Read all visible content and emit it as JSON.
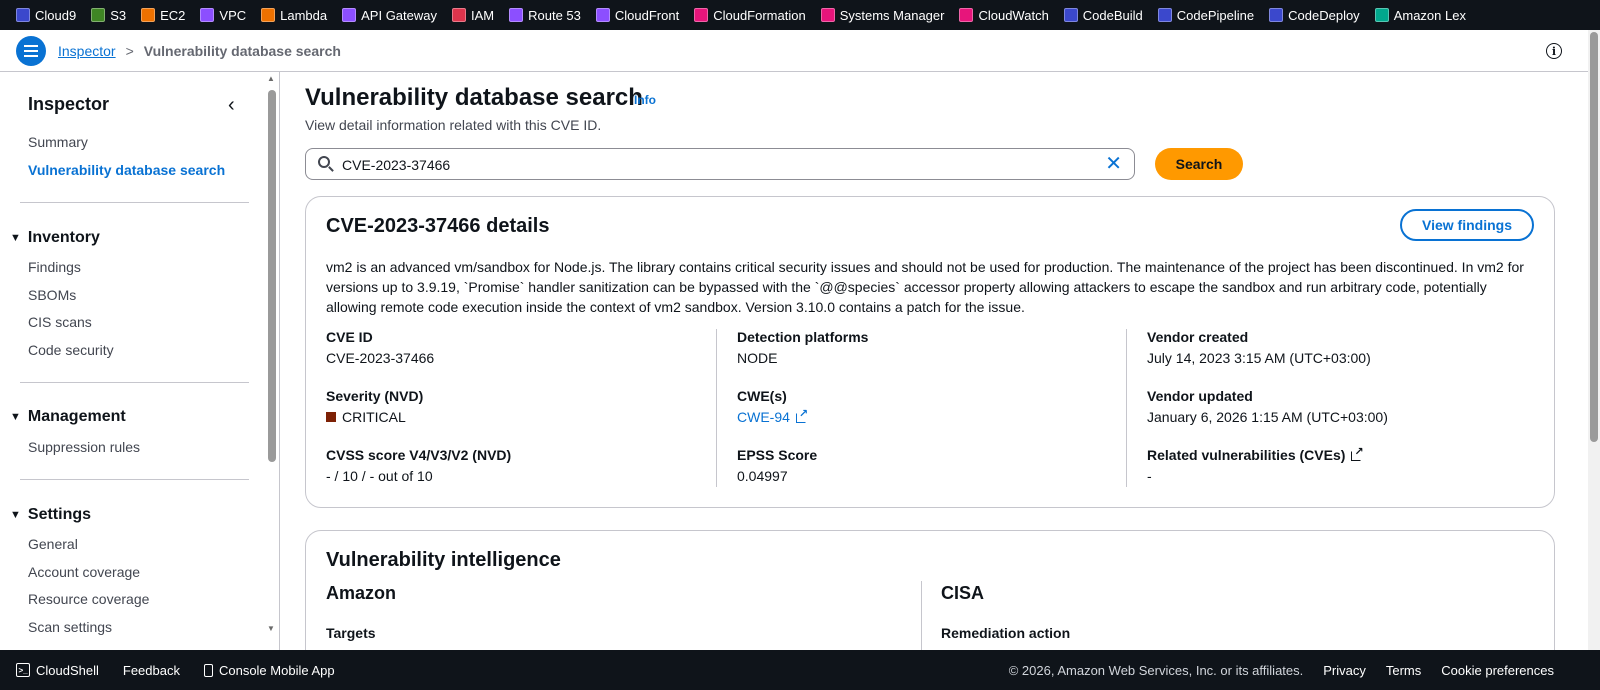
{
  "services": [
    {
      "label": "Cloud9",
      "icon": "cloud9-icon",
      "color": "#3b48cc"
    },
    {
      "label": "S3",
      "icon": "s3-icon",
      "color": "#3f8624"
    },
    {
      "label": "EC2",
      "icon": "ec2-icon",
      "color": "#ed7100"
    },
    {
      "label": "VPC",
      "icon": "vpc-icon",
      "color": "#8c4fff"
    },
    {
      "label": "Lambda",
      "icon": "lambda-icon",
      "color": "#ed7100"
    },
    {
      "label": "API Gateway",
      "icon": "api-gateway-icon",
      "color": "#8c4fff"
    },
    {
      "label": "IAM",
      "icon": "iam-icon",
      "color": "#dd344c"
    },
    {
      "label": "Route 53",
      "icon": "route53-icon",
      "color": "#8c4fff"
    },
    {
      "label": "CloudFront",
      "icon": "cloudfront-icon",
      "color": "#8c4fff"
    },
    {
      "label": "CloudFormation",
      "icon": "cloudformation-icon",
      "color": "#e7157b"
    },
    {
      "label": "Systems Manager",
      "icon": "systems-manager-icon",
      "color": "#e7157b"
    },
    {
      "label": "CloudWatch",
      "icon": "cloudwatch-icon",
      "color": "#e7157b"
    },
    {
      "label": "CodeBuild",
      "icon": "codebuild-icon",
      "color": "#3b48cc"
    },
    {
      "label": "CodePipeline",
      "icon": "codepipeline-icon",
      "color": "#3b48cc"
    },
    {
      "label": "CodeDeploy",
      "icon": "codedeploy-icon",
      "color": "#3b48cc"
    },
    {
      "label": "Amazon Lex",
      "icon": "amazon-lex-icon",
      "color": "#01a88d"
    }
  ],
  "breadcrumb": {
    "parent": "Inspector",
    "separator": ">",
    "current": "Vulnerability database search"
  },
  "sidebar": {
    "title": "Inspector",
    "top_links": [
      "Summary",
      "Vulnerability database search"
    ],
    "sections": [
      {
        "title": "Inventory",
        "items": [
          "Findings",
          "SBOMs",
          "CIS scans",
          "Code security"
        ]
      },
      {
        "title": "Management",
        "items": [
          "Suppression rules"
        ]
      },
      {
        "title": "Settings",
        "items": [
          "General",
          "Account coverage",
          "Resource coverage",
          "Scan settings"
        ]
      }
    ]
  },
  "page": {
    "title": "Vulnerability database search",
    "info_label": "Info",
    "description": "View detail information related with this CVE ID.",
    "search": {
      "value": "CVE-2023-37466",
      "button_label": "Search"
    }
  },
  "details": {
    "title": "CVE-2023-37466 details",
    "view_findings_label": "View findings",
    "description": "vm2 is an advanced vm/sandbox for Node.js. The library contains critical security issues and should not be used for production. The maintenance of the project has been discontinued. In vm2 for versions up to 3.9.19, `Promise` handler sanitization can be bypassed with the `@@species` accessor property allowing attackers to escape the sandbox and run arbitrary code, potentially allowing remote code execution inside the context of vm2 sandbox. Version 3.10.0 contains a patch for the issue.",
    "cve_id_label": "CVE ID",
    "cve_id_value": "CVE-2023-37466",
    "severity_label": "Severity (NVD)",
    "severity_value": "CRITICAL",
    "severity_color": "#7d2105",
    "cvss_label": "CVSS score V4/V3/V2 (NVD)",
    "cvss_value": "- / 10 / - out of 10",
    "detection_label": "Detection platforms",
    "detection_value": "NODE",
    "cwe_label": "CWE(s)",
    "cwe_value": "CWE-94",
    "epss_label": "EPSS Score",
    "epss_value": "0.04997",
    "vendor_created_label": "Vendor created",
    "vendor_created_value": "July 14, 2023 3:15 AM (UTC+03:00)",
    "vendor_updated_label": "Vendor updated",
    "vendor_updated_value": "January 6, 2026 1:15 AM (UTC+03:00)",
    "related_label": "Related vulnerabilities (CVEs)",
    "related_value": "-"
  },
  "intelligence": {
    "title": "Vulnerability intelligence",
    "amazon_heading": "Amazon",
    "amazon_targets_label": "Targets",
    "cisa_heading": "CISA",
    "cisa_remediation_label": "Remediation action"
  },
  "footer": {
    "cloudshell": "CloudShell",
    "feedback": "Feedback",
    "mobile_app": "Console Mobile App",
    "copyright": "© 2026, Amazon Web Services, Inc. or its affiliates.",
    "privacy": "Privacy",
    "terms": "Terms",
    "cookies": "Cookie preferences"
  },
  "colors": {
    "accent": "#0972d3",
    "primary_button": "#ff9900",
    "top_bar": "#0f141a"
  }
}
